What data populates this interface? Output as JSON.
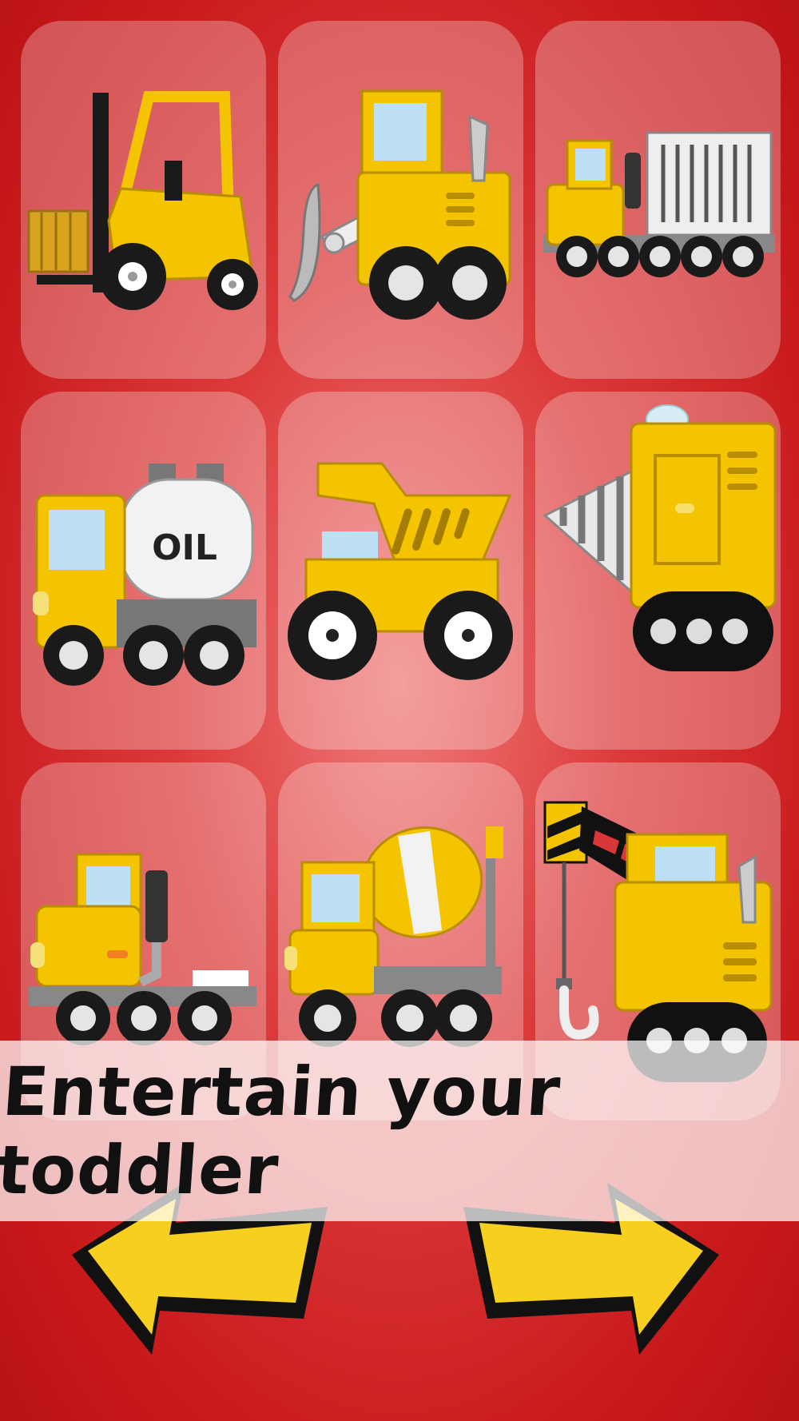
{
  "app": {
    "tagline": "Entertain your toddler"
  },
  "vehicles": [
    {
      "name": "Forklift",
      "icon": "forklift-icon"
    },
    {
      "name": "Bulldozer",
      "icon": "bulldozer-icon"
    },
    {
      "name": "Container truck",
      "icon": "container-truck-icon"
    },
    {
      "name": "Oil tanker",
      "icon": "oil-tanker-icon",
      "label": "OIL"
    },
    {
      "name": "Dump truck",
      "icon": "dump-truck-icon"
    },
    {
      "name": "Drilling machine",
      "icon": "drill-icon"
    },
    {
      "name": "Tow truck",
      "icon": "tow-truck-icon"
    },
    {
      "name": "Cement mixer",
      "icon": "cement-mixer-icon"
    },
    {
      "name": "Crane",
      "icon": "crane-icon"
    }
  ],
  "nav": {
    "prev": "arrow-left-icon",
    "next": "arrow-right-icon"
  },
  "colors": {
    "background": "#c8181a",
    "vehicle_yellow": "#f5c400",
    "arrow_yellow": "#f7cf1e",
    "outline": "#1a1a1a"
  }
}
